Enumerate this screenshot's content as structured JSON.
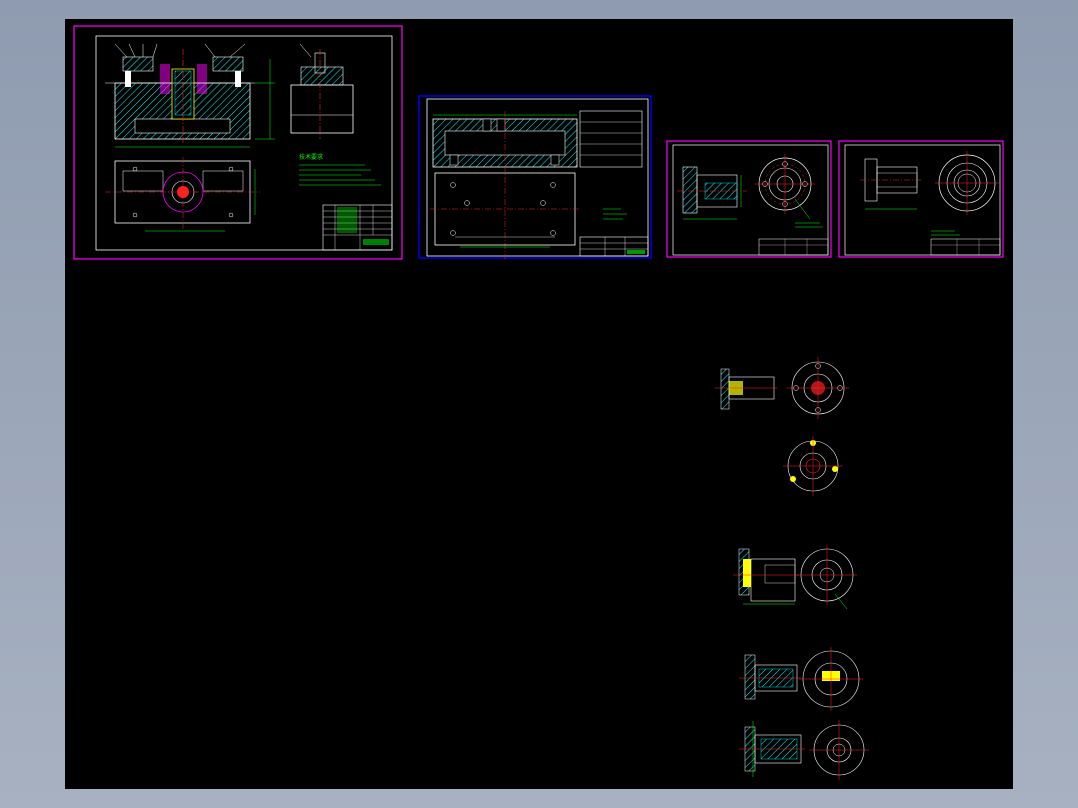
{
  "viewer": {
    "background_color": "#000000",
    "frame_color": "#9aa6b8"
  },
  "sheets": [
    {
      "id": "assembly-drawing",
      "frame_color": "#ff00ff",
      "title_note": "技术要求"
    },
    {
      "id": "base-part-drawing",
      "frame_color": "#0000ff"
    },
    {
      "id": "flange-part-drawing-1",
      "frame_color": "#ff00ff"
    },
    {
      "id": "flange-part-drawing-2",
      "frame_color": "#ff00ff"
    }
  ],
  "process_views": [
    {
      "id": "process-step-1"
    },
    {
      "id": "process-step-2"
    },
    {
      "id": "process-step-3"
    },
    {
      "id": "process-step-4"
    },
    {
      "id": "process-step-5"
    }
  ],
  "colors": {
    "outline": "#ffffff",
    "centerline": "#ff2020",
    "dimension": "#00ff00",
    "hatch": "#00ffff",
    "highlight": "#ffff00",
    "frame_magenta": "#ff00ff",
    "frame_blue": "#0000ff"
  }
}
